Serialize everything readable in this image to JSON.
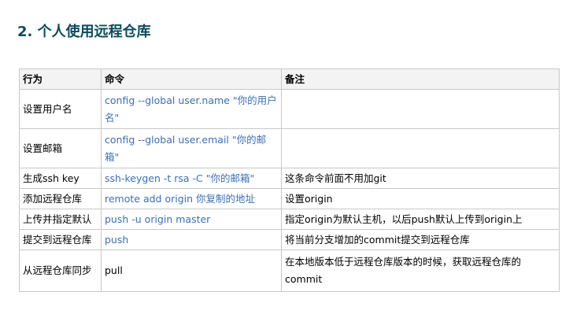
{
  "heading": "2. 个人使用远程仓库",
  "table": {
    "headers": [
      "行为",
      "命令",
      "备注"
    ],
    "rows": [
      {
        "action": "设置用户名",
        "command": "config --global user.name \"你的用户名\"",
        "note": ""
      },
      {
        "action": "设置邮箱",
        "command": "config --global user.email \"你的邮箱\"",
        "note": ""
      },
      {
        "action": "生成ssh key",
        "command": "ssh-keygen -t rsa -C \"你的邮箱\"",
        "note": "这条命令前面不用加git"
      },
      {
        "action": "添加远程仓库",
        "command": "remote add origin 你复制的地址",
        "note": "设置origin"
      },
      {
        "action": "上传并指定默认",
        "command": "push -u origin master",
        "note": "指定origin为默认主机，以后push默认上传到origin上"
      },
      {
        "action": "提交到远程仓库",
        "command": "push",
        "note": "将当前分支增加的commit提交到远程仓库"
      },
      {
        "action": "从远程仓库同步",
        "command": "pull",
        "note": "在本地版本低于远程仓库版本的时候，获取远程仓库的commit"
      }
    ]
  },
  "colors": {
    "heading": "#0b4c5f",
    "command_link": "#3b6fb6",
    "border": "#c8c8c8",
    "header_bg": "#f3f3f3"
  }
}
